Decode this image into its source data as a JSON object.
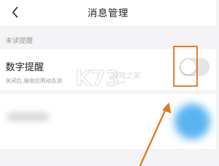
{
  "header": {
    "title": "消息管理",
    "back_icon": "chevron-left-icon"
  },
  "section": {
    "label": "未读提醒"
  },
  "setting_row": {
    "title": "数字提醒",
    "description": "关闭后,接收应用动态消",
    "toggle_on": false
  },
  "watermark": {
    "logo": "K73",
    "site": "游戏之家",
    "url": ".com"
  },
  "colors": {
    "highlight": "#e07a1f",
    "toggle_off": "#e6e6e8",
    "blur_accent": "#59b4f1"
  }
}
